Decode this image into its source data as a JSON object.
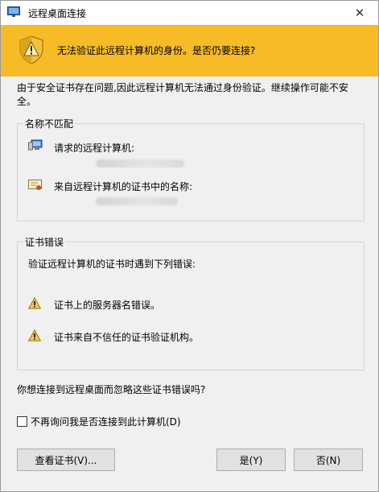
{
  "window": {
    "title": "远程桌面连接",
    "close_glyph": "✕"
  },
  "banner": {
    "text": "无法验证此远程计算机的身份。是否仍要连接?",
    "color": "#f6bb26",
    "icon": "shield-warning-icon"
  },
  "description": "由于安全证书存在问题,因此远程计算机无法通过身份验证。继续操作可能不安全。",
  "name_mismatch": {
    "group_title": "名称不匹配",
    "requested_label": "请求的远程计算机:",
    "requested_icon": "computer-icon",
    "cert_name_label": "来自远程计算机的证书中的名称:",
    "cert_icon": "certificate-icon"
  },
  "cert_errors": {
    "group_title": "证书错误",
    "intro": "验证远程计算机的证书时遇到下列错误:",
    "items": [
      {
        "text": "证书上的服务器名错误。",
        "icon": "warning-icon"
      },
      {
        "text": "证书来自不信任的证书验证机构。",
        "icon": "warning-icon"
      }
    ]
  },
  "question": "你想连接到远程桌面而忽略这些证书错误吗?",
  "dont_ask": {
    "label": "不再询问我是否连接到此计算机(D)",
    "checked": false
  },
  "buttons": {
    "view_cert": "查看证书(V)...",
    "yes": "是(Y)",
    "no": "否(N)"
  }
}
